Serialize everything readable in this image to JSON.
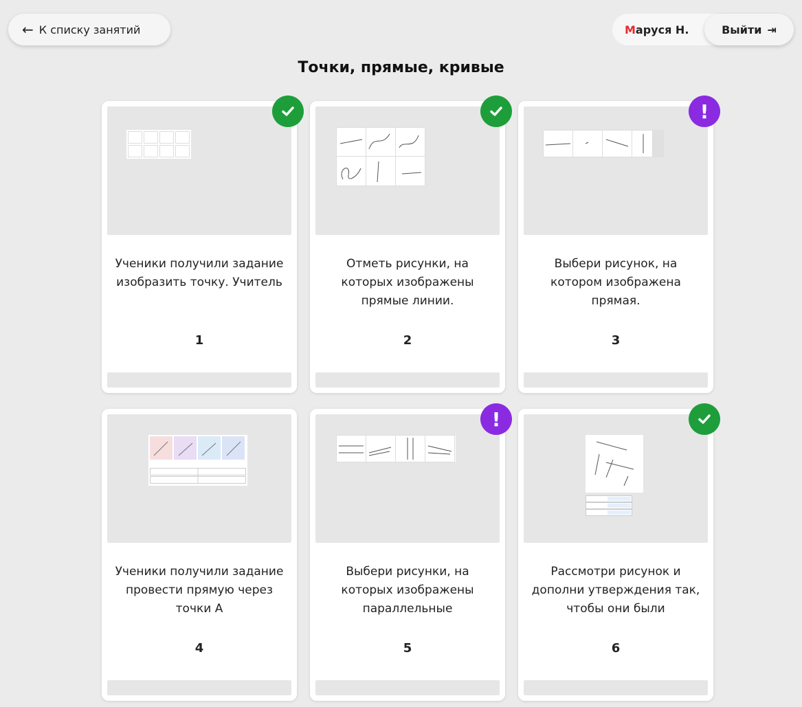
{
  "header": {
    "back_label": "К списку занятий",
    "user_initial": "М",
    "user_rest": "аруся Н.",
    "logout_label": "Выйти"
  },
  "title": "Точки, прямые, кривые",
  "colors": {
    "done": "#1d9e3a",
    "warn": "#8a2be2",
    "initial": "#e52b2b"
  },
  "cards": [
    {
      "text": "Ученики получили задание изобразить точку. Учитель",
      "num": "1",
      "status": "done"
    },
    {
      "text": "Отметь рисунки, на которых изображены прямые линии.",
      "num": "2",
      "status": "done"
    },
    {
      "text": "Выбери рисунок, на котором изображена прямая.",
      "num": "3",
      "status": "warn"
    },
    {
      "text": "Ученики получили задание провести прямую через точки A",
      "num": "4",
      "status": "none"
    },
    {
      "text": "Выбери рисунки, на которых изображены параллельные",
      "num": "5",
      "status": "warn"
    },
    {
      "text": "Рассмотри рисунок и дополни утверждения так, чтобы они были",
      "num": "6",
      "status": "done"
    }
  ]
}
